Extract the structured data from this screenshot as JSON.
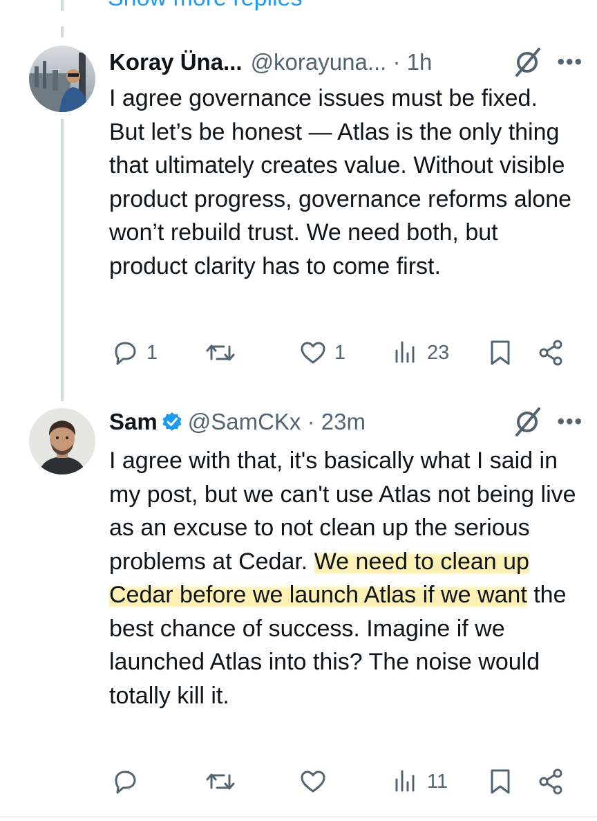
{
  "show_more": "Show more replies",
  "tweets": [
    {
      "name": "Koray Üna...",
      "handle": "@korayuna... · 1h",
      "verified": false,
      "text_plain": "I agree governance issues must be fixed. But let’s be honest — Atlas is the only thing that ultimately creates value. Without visible product progress, governance reforms alone won’t rebuild trust. We need both, but product clarity has to come first.",
      "actions": {
        "replies": "1",
        "reposts": "",
        "likes": "1",
        "views": "23"
      }
    },
    {
      "name": "Sam",
      "handle": "@SamCKx · 23m",
      "verified": true,
      "text_before": "I agree with that, it's basically what I said in my post, but we can't use Atlas not being live as an excuse to not clean up the serious problems at Cedar. ",
      "text_highlight": "We need to clean up Cedar before we launch Atlas if we want",
      "text_after": " the best chance of success. Imagine if we launched Atlas into this? The noise would totally kill it.",
      "actions": {
        "replies": "",
        "reposts": "",
        "likes": "",
        "views": "11"
      }
    }
  ],
  "colors": {
    "accent": "#1d9bf0",
    "muted": "#536471",
    "highlight": "#fdefb0",
    "thread_line": "#cfd9de"
  },
  "icons": [
    "grok-icon",
    "more-icon",
    "reply-icon",
    "repost-icon",
    "like-icon",
    "views-icon",
    "bookmark-icon",
    "share-icon",
    "verified-badge-icon"
  ]
}
